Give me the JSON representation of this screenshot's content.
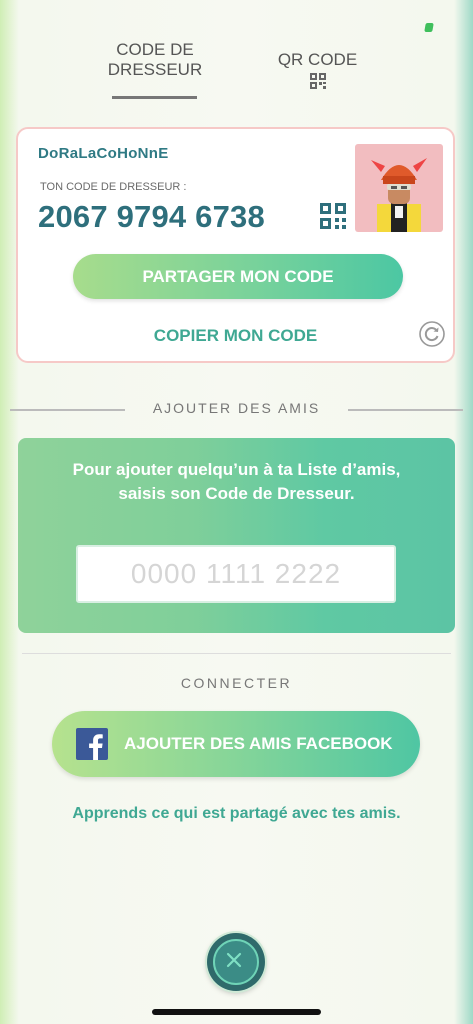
{
  "tabs": [
    {
      "label": "CODE DE\nDRESSEUR"
    },
    {
      "label": "QR CODE"
    }
  ],
  "profile": {
    "trainer_name": "DoRaLaCoHoNnE",
    "code_label": "TON CODE DE DRESSEUR :",
    "trainer_code": "2067 9794 6738",
    "share_label": "PARTAGER MON CODE",
    "copy_label": "COPIER MON CODE"
  },
  "add_friends": {
    "section_title": "AJOUTER DES AMIS",
    "instructions": "Pour ajouter quelqu’un à ta Liste d’amis, saisis son Code de Dresseur.",
    "input_placeholder": "0000 1111 2222",
    "input_value": ""
  },
  "connect": {
    "section_title": "CONNECTER",
    "facebook_label": "AJOUTER DES AMIS FACEBOOK",
    "learn_link": "Apprends ce qui est partagé avec tes amis."
  },
  "colors": {
    "accent_teal": "#3fa893",
    "code_text": "#2e6f7c",
    "facebook_blue": "#3b5998",
    "card_border": "#f6c9c7"
  }
}
